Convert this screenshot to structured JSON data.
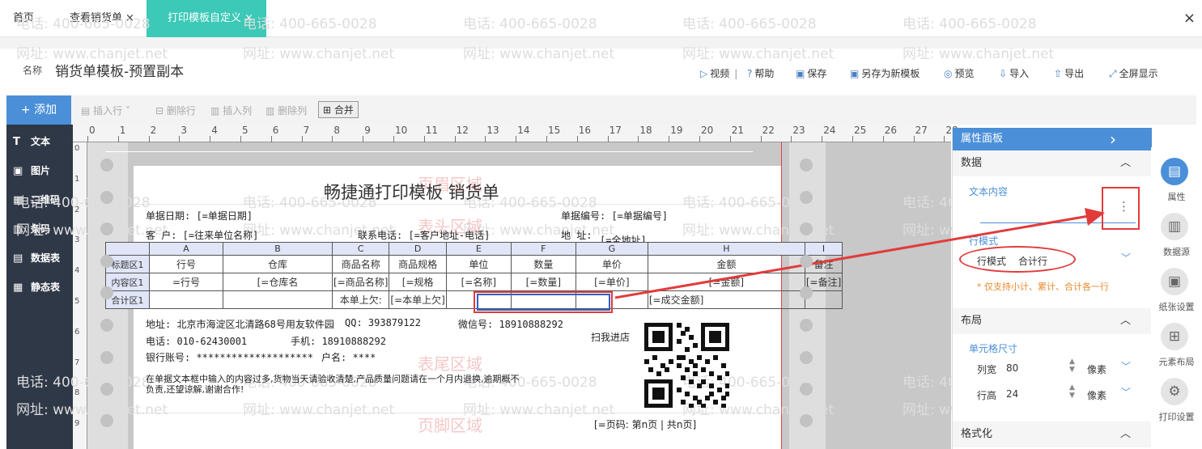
{
  "tabs": {
    "home": "首页",
    "sales": "查看销货单",
    "print": "打印模板自定义",
    "close_glyph": "×"
  },
  "title": {
    "label": "名称",
    "value": "销货单模板-预置副本"
  },
  "actions": {
    "video": "视频",
    "help": "帮助",
    "save": "保存",
    "saveas": "另存为新模板",
    "preview": "预览",
    "import": "导入",
    "export": "导出",
    "fullscreen": "全屏显示"
  },
  "toolbar": {
    "add": "+ 添加",
    "insert_row": "插入行",
    "delete_row": "删除行",
    "insert_col": "插入列",
    "delete_col": "删除列",
    "merge": "合并"
  },
  "left_items": [
    "文本",
    "图片",
    "二维码",
    "条码",
    "数据表",
    "静态表"
  ],
  "ruler_h": [
    "0",
    "1",
    "2",
    "3",
    "4",
    "5",
    "6",
    "7",
    "8",
    "9",
    "10",
    "11",
    "12",
    "13",
    "14",
    "15",
    "16",
    "17",
    "18",
    "19",
    "20",
    "21",
    "22",
    "23",
    "24",
    "25",
    "26",
    "27",
    "28"
  ],
  "ruler_v": [
    "0",
    "1",
    "2",
    "3",
    "4",
    "5",
    "6",
    "7",
    "8",
    "9"
  ],
  "watermark": {
    "phone": "电话: 400-665-0028",
    "site": "网址: www.chanjet.net"
  },
  "zones": {
    "header": "页眉区域",
    "table_head": "表头区域",
    "table_foot": "表尾区域",
    "footer": "页脚区域"
  },
  "doc": {
    "title": "畅捷通打印模板 销货单",
    "date_label": "单据日期: [=单据日期]",
    "no_label": "单据编号: [=单据编号]",
    "customer": "客    户: [=往来单位名称]",
    "phone": "联系电话: [=客户地址-电话]",
    "address": "地  址:",
    "address_val": "[=全地址]",
    "footer_addr": "地址: 北京市海淀区北清路68号用友软件园",
    "qq": "QQ: 393879122",
    "wechat": "微信号: 18910888292",
    "tel": "电话: 010-62430001",
    "mobile": "手机: 18910888292",
    "bank": "银行账号: ********************",
    "account": "户名: ****",
    "scan": "扫我进店",
    "notice1": "在单据文本框中输入的内容过多,货物当天请验收清楚,产品质量问题请在一个月内退换,逾期概不",
    "notice2": "负责,还望谅解,谢谢合作!",
    "page": "[=页码: 第n页 | 共n页]"
  },
  "grid": {
    "columns": [
      "A",
      "B",
      "C",
      "D",
      "E",
      "F",
      "G",
      "H",
      "I"
    ],
    "rows": [
      {
        "label": "标题区1",
        "cells": [
          "行号",
          "仓库",
          "商品名称",
          "商品规格",
          "单位",
          "数量",
          "单价",
          "金额",
          "备注"
        ]
      },
      {
        "label": "内容区1",
        "cells": [
          "=行号",
          "[=仓库名",
          "[=商品名称]",
          "[=规格",
          "[=名称]",
          "[=数量]",
          "[=单价]",
          "[=金额]",
          "[=备注]"
        ]
      },
      {
        "label": "合计区1",
        "cells": [
          "",
          "",
          "本单上欠:",
          "[=本单上欠]",
          "",
          "",
          "",
          "[=成交金额]",
          ""
        ]
      }
    ]
  },
  "panel": {
    "title": "属性面板",
    "expand_glyph": "›",
    "data_section": "数据",
    "text_content": "文本内容",
    "more_glyph": "⋮",
    "row_mode_label": "行模式",
    "row_mode_field": "行模式",
    "row_mode_value": "合计行",
    "note": "* 仅支持小计、累计、合计各一行",
    "layout_section": "布局",
    "cell_size": "单元格尺寸",
    "col_width_label": "列宽",
    "col_width": "80",
    "row_height_label": "行高",
    "row_height": "24",
    "unit": "像素",
    "format_section": "格式化"
  },
  "side_icons": [
    "属性",
    "数据源",
    "纸张设置",
    "元素布局",
    "打印设置"
  ],
  "colors": {
    "accent": "#3cc9b7",
    "blue": "#4a8fd8",
    "red": "#e23b3b",
    "dark": "#2f3847"
  }
}
